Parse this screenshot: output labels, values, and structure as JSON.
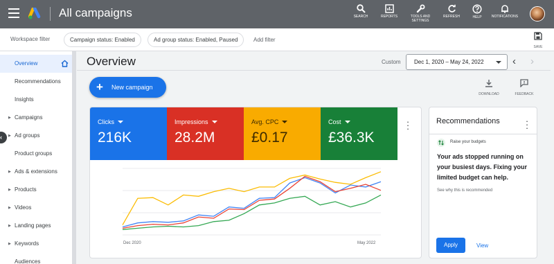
{
  "topbar": {
    "title": "All campaigns",
    "buttons": [
      {
        "label": "SEARCH",
        "icon": "search-icon"
      },
      {
        "label": "REPORTS",
        "icon": "reports-icon"
      },
      {
        "label": "TOOLS AND\nSETTINGS",
        "icon": "wrench-icon"
      },
      {
        "label": "REFRESH",
        "icon": "refresh-icon"
      },
      {
        "label": "HELP",
        "icon": "help-icon"
      },
      {
        "label": "NOTIFICATIONS",
        "icon": "bell-icon"
      }
    ]
  },
  "filterbar": {
    "workspace_label": "Workspace filter",
    "chips": [
      "Campaign status: Enabled",
      "Ad group status: Enabled, Paused"
    ],
    "add_filter": "Add filter",
    "save_label": "SAVE"
  },
  "sidebar": {
    "items": [
      {
        "label": "Overview",
        "expandable": false
      },
      {
        "label": "Recommendations",
        "expandable": false
      },
      {
        "label": "Insights",
        "expandable": false
      },
      {
        "label": "Campaigns",
        "expandable": true
      },
      {
        "label": "Ad groups",
        "expandable": true
      },
      {
        "label": "Product groups",
        "expandable": false
      },
      {
        "label": "Ads & extensions",
        "expandable": true
      },
      {
        "label": "Products",
        "expandable": true
      },
      {
        "label": "Videos",
        "expandable": true
      },
      {
        "label": "Landing pages",
        "expandable": true
      },
      {
        "label": "Keywords",
        "expandable": true
      },
      {
        "label": "Audiences",
        "expandable": false
      }
    ]
  },
  "main": {
    "title": "Overview",
    "date_mode": "Custom",
    "date_range": "Dec 1, 2020 – May 24, 2022",
    "new_campaign": "New campaign",
    "download_label": "DOWNLOAD",
    "feedback_label": "FEEDBACK"
  },
  "metrics": [
    {
      "label": "Clicks",
      "value": "216K",
      "color": "#1a73e8"
    },
    {
      "label": "Impressions",
      "value": "28.2M",
      "color": "#d93025"
    },
    {
      "label": "Avg. CPC",
      "value": "£0.17",
      "color": "#f9ab00"
    },
    {
      "label": "Cost",
      "value": "£36.3K",
      "color": "#188038"
    }
  ],
  "chart_data": {
    "type": "line",
    "x_start_label": "Dec 2020",
    "x_end_label": "May 2022",
    "grid": true,
    "legend": "none",
    "series": [
      {
        "name": "Clicks",
        "color": "#4285f4",
        "values": [
          12,
          18,
          20,
          19,
          21,
          30,
          28,
          42,
          40,
          55,
          56,
          78,
          86,
          78,
          63,
          75,
          72,
          80
        ]
      },
      {
        "name": "Impressions",
        "color": "#ea4335",
        "values": [
          10,
          14,
          16,
          15,
          18,
          27,
          25,
          39,
          38,
          52,
          54,
          70,
          88,
          80,
          65,
          70,
          76,
          67
        ]
      },
      {
        "name": "Avg. CPC",
        "color": "#fbbc04",
        "values": [
          15,
          55,
          56,
          45,
          60,
          58,
          65,
          70,
          65,
          72,
          72,
          85,
          90,
          84,
          79,
          76,
          86,
          95
        ]
      },
      {
        "name": "Cost",
        "color": "#34a853",
        "values": [
          8,
          10,
          12,
          13,
          12,
          14,
          20,
          22,
          32,
          45,
          48,
          55,
          58,
          45,
          50,
          42,
          48,
          60
        ]
      }
    ],
    "ylim": [
      0,
      100
    ]
  },
  "recommendations": {
    "title": "Recommendations",
    "subtitle": "Raise your budgets",
    "body": "Your ads stopped running on your busiest days. Fixing your limited budget can help.",
    "why": "See why this is recommended",
    "apply": "Apply",
    "view": "View"
  }
}
